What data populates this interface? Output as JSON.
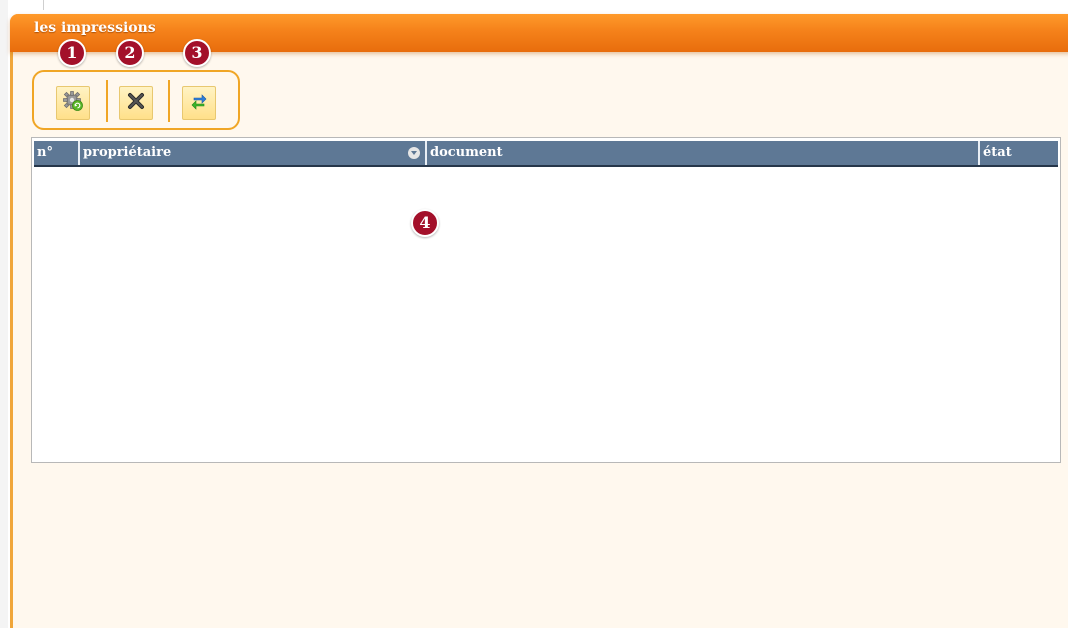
{
  "window": {
    "title": "les impressions"
  },
  "toolbar": {
    "buttons": [
      {
        "name": "purge-button",
        "icon": "gear-recycle-icon"
      },
      {
        "name": "delete-button",
        "icon": "close-x-icon"
      },
      {
        "name": "refresh-button",
        "icon": "refresh-arrows-icon"
      }
    ]
  },
  "badges": [
    "1",
    "2",
    "3",
    "4"
  ],
  "table": {
    "columns": [
      "n°",
      "propriétaire",
      "document",
      "état"
    ],
    "rows": []
  },
  "colors": {
    "titlebar": "#f5811a",
    "header": "#5e7895",
    "badge": "#a3102a",
    "toolbar_border": "#f0a626",
    "background": "#fff8ee"
  }
}
